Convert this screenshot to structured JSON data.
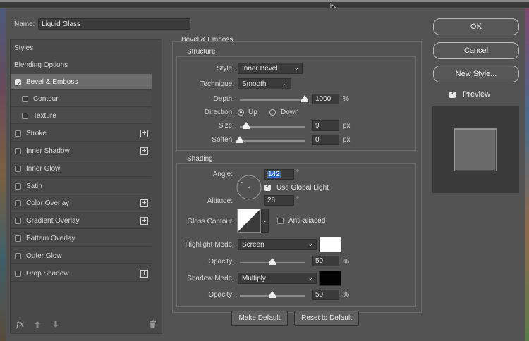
{
  "dialog": {
    "name_label": "Name:",
    "name_value": "Liquid Glass"
  },
  "left_panel": {
    "items": [
      {
        "label": "Styles"
      },
      {
        "label": "Blending Options"
      },
      {
        "label": "Bevel & Emboss",
        "checked": true,
        "selected": true
      },
      {
        "label": "Contour",
        "checked": false
      },
      {
        "label": "Texture",
        "checked": false
      },
      {
        "label": "Stroke",
        "checked": false,
        "plus": true
      },
      {
        "label": "Inner Shadow",
        "checked": false,
        "plus": true
      },
      {
        "label": "Inner Glow",
        "checked": false
      },
      {
        "label": "Satin",
        "checked": false
      },
      {
        "label": "Color Overlay",
        "checked": false,
        "plus": true
      },
      {
        "label": "Gradient Overlay",
        "checked": false,
        "plus": true
      },
      {
        "label": "Pattern Overlay",
        "checked": false
      },
      {
        "label": "Outer Glow",
        "checked": false
      },
      {
        "label": "Drop Shadow",
        "checked": false,
        "plus": true
      }
    ],
    "footer": {
      "fx": "fx",
      "up_icon": "arrow-up-icon",
      "down_icon": "arrow-down-icon",
      "trash_icon": "trash-icon"
    }
  },
  "bevel": {
    "title": "Bevel & Emboss",
    "structure_title": "Structure",
    "style_label": "Style:",
    "style_value": "Inner Bevel",
    "technique_label": "Technique:",
    "technique_value": "Smooth",
    "depth_label": "Depth:",
    "depth_value": "1000",
    "depth_unit": "%",
    "depth_level": 1.0,
    "direction_label": "Direction:",
    "direction_up": "Up",
    "direction_down": "Down",
    "size_label": "Size:",
    "size_value": "9",
    "size_unit": "px",
    "size_level": 0.04,
    "soften_label": "Soften:",
    "soften_value": "0",
    "soften_unit": "px",
    "soften_level": 0.0
  },
  "shading": {
    "title": "Shading",
    "angle_label": "Angle:",
    "angle_value": "142",
    "angle_unit": "°",
    "use_global_light": "Use Global Light",
    "altitude_label": "Altitude:",
    "altitude_value": "26",
    "altitude_unit": "°",
    "gloss_contour_label": "Gloss Contour:",
    "anti_aliased": "Anti-aliased",
    "highlight_mode_label": "Highlight Mode:",
    "highlight_mode_value": "Screen",
    "highlight_color": "#ffffff",
    "opacity_label": "Opacity:",
    "highlight_opacity": "50",
    "shadow_mode_label": "Shadow Mode:",
    "shadow_mode_value": "Multiply",
    "shadow_color": "#000000",
    "shadow_opacity": "50",
    "opacity_unit": "%",
    "opacity_level": 0.5
  },
  "buttons": {
    "make_default": "Make Default",
    "reset_default": "Reset to Default",
    "ok": "OK",
    "cancel": "Cancel",
    "new_style": "New Style...",
    "preview": "Preview"
  }
}
